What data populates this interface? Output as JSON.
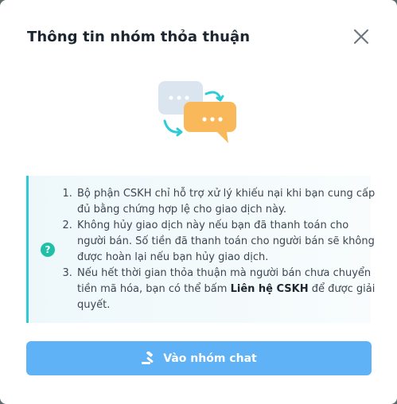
{
  "dialog": {
    "title": "Thông tin nhóm thỏa thuận",
    "close_icon": "close-icon"
  },
  "info": {
    "icon": "question-icon",
    "icon_glyph": "?",
    "items": [
      {
        "text": "Bộ phận CSKH chỉ hỗ trợ xử lý khiếu nại khi bạn cung cấp đủ bằng chứng hợp lệ cho giao dịch này."
      },
      {
        "text": "Không hủy giao dịch này nếu bạn đã thanh toán cho người bán. Số tiền đã thanh toán cho người bán sẽ không được hoàn lại nếu bạn hủy giao dịch."
      },
      {
        "text_before": "Nếu hết thời gian thỏa thuận mà người bán chưa chuyển tiền mã hóa, bạn có thể bấm ",
        "bold": "Liên hệ CSKH",
        "text_after": " để được giải quyết."
      }
    ]
  },
  "button": {
    "label": "Vào nhóm chat",
    "icon": "gavel-icon",
    "color": "#5eb2f5"
  },
  "colors": {
    "accent_border": "#2ecad6",
    "question_icon": "#20bfa8",
    "bubble_front": "#f9b95a",
    "bubble_back": "#dbe5ef"
  }
}
